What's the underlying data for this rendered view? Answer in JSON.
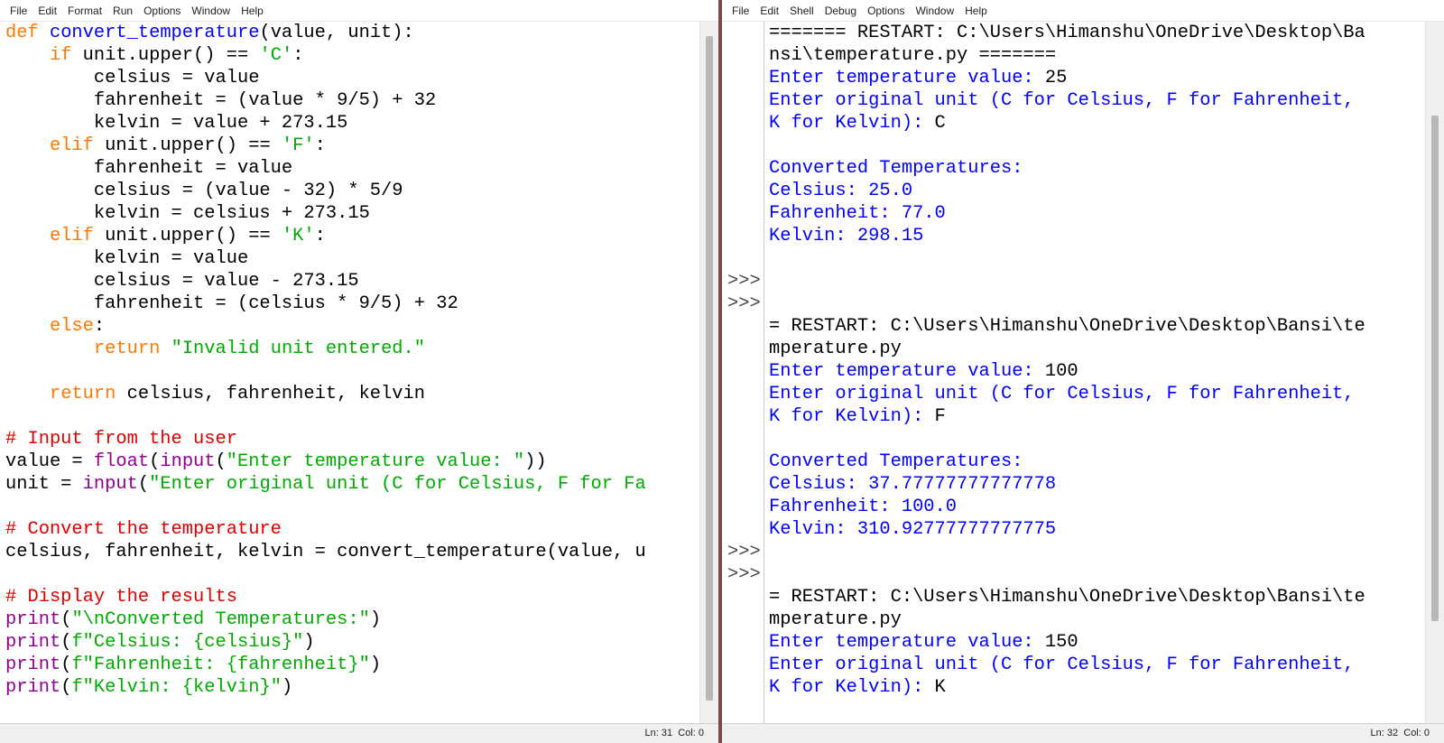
{
  "editor": {
    "menu": [
      "File",
      "Edit",
      "Format",
      "Run",
      "Options",
      "Window",
      "Help"
    ],
    "status": {
      "line": "Ln: 31",
      "col": "Col: 0"
    },
    "code": [
      [
        {
          "t": "def ",
          "c": "kw"
        },
        {
          "t": "convert_temperature",
          "c": "fn"
        },
        {
          "t": "(value, unit):",
          "c": "pl"
        }
      ],
      [
        {
          "t": "    ",
          "c": "pl"
        },
        {
          "t": "if",
          "c": "kw"
        },
        {
          "t": " unit.upper() == ",
          "c": "pl"
        },
        {
          "t": "'C'",
          "c": "str"
        },
        {
          "t": ":",
          "c": "pl"
        }
      ],
      [
        {
          "t": "        celsius = value",
          "c": "pl"
        }
      ],
      [
        {
          "t": "        fahrenheit = (value * 9/5) + 32",
          "c": "pl"
        }
      ],
      [
        {
          "t": "        kelvin = value + 273.15",
          "c": "pl"
        }
      ],
      [
        {
          "t": "    ",
          "c": "pl"
        },
        {
          "t": "elif",
          "c": "kw"
        },
        {
          "t": " unit.upper() == ",
          "c": "pl"
        },
        {
          "t": "'F'",
          "c": "str"
        },
        {
          "t": ":",
          "c": "pl"
        }
      ],
      [
        {
          "t": "        fahrenheit = value",
          "c": "pl"
        }
      ],
      [
        {
          "t": "        celsius = (value - 32) * 5/9",
          "c": "pl"
        }
      ],
      [
        {
          "t": "        kelvin = celsius + 273.15",
          "c": "pl"
        }
      ],
      [
        {
          "t": "    ",
          "c": "pl"
        },
        {
          "t": "elif",
          "c": "kw"
        },
        {
          "t": " unit.upper() == ",
          "c": "pl"
        },
        {
          "t": "'K'",
          "c": "str"
        },
        {
          "t": ":",
          "c": "pl"
        }
      ],
      [
        {
          "t": "        kelvin = value",
          "c": "pl"
        }
      ],
      [
        {
          "t": "        celsius = value - 273.15",
          "c": "pl"
        }
      ],
      [
        {
          "t": "        fahrenheit = (celsius * 9/5) + 32",
          "c": "pl"
        }
      ],
      [
        {
          "t": "    ",
          "c": "pl"
        },
        {
          "t": "else",
          "c": "kw"
        },
        {
          "t": ":",
          "c": "pl"
        }
      ],
      [
        {
          "t": "        ",
          "c": "pl"
        },
        {
          "t": "return",
          "c": "kw"
        },
        {
          "t": " ",
          "c": "pl"
        },
        {
          "t": "\"Invalid unit entered.\"",
          "c": "str"
        }
      ],
      [
        {
          "t": "",
          "c": "pl"
        }
      ],
      [
        {
          "t": "    ",
          "c": "pl"
        },
        {
          "t": "return",
          "c": "kw"
        },
        {
          "t": " celsius, fahrenheit, kelvin",
          "c": "pl"
        }
      ],
      [
        {
          "t": "",
          "c": "pl"
        }
      ],
      [
        {
          "t": "# Input from the user",
          "c": "cm"
        }
      ],
      [
        {
          "t": "value = ",
          "c": "pl"
        },
        {
          "t": "float",
          "c": "bi"
        },
        {
          "t": "(",
          "c": "pl"
        },
        {
          "t": "input",
          "c": "bi"
        },
        {
          "t": "(",
          "c": "pl"
        },
        {
          "t": "\"Enter temperature value: \"",
          "c": "str"
        },
        {
          "t": "))",
          "c": "pl"
        }
      ],
      [
        {
          "t": "unit = ",
          "c": "pl"
        },
        {
          "t": "input",
          "c": "bi"
        },
        {
          "t": "(",
          "c": "pl"
        },
        {
          "t": "\"Enter original unit (C for Celsius, F for Fa",
          "c": "str"
        }
      ],
      [
        {
          "t": "",
          "c": "pl"
        }
      ],
      [
        {
          "t": "# Convert the temperature",
          "c": "cm"
        }
      ],
      [
        {
          "t": "celsius, fahrenheit, kelvin = convert_temperature(value, u",
          "c": "pl"
        }
      ],
      [
        {
          "t": "",
          "c": "pl"
        }
      ],
      [
        {
          "t": "# Display the results",
          "c": "cm"
        }
      ],
      [
        {
          "t": "print",
          "c": "bi"
        },
        {
          "t": "(",
          "c": "pl"
        },
        {
          "t": "\"\\nConverted Temperatures:\"",
          "c": "str"
        },
        {
          "t": ")",
          "c": "pl"
        }
      ],
      [
        {
          "t": "print",
          "c": "bi"
        },
        {
          "t": "(",
          "c": "pl"
        },
        {
          "t": "f\"Celsius: {celsius}\"",
          "c": "str"
        },
        {
          "t": ")",
          "c": "pl"
        }
      ],
      [
        {
          "t": "print",
          "c": "bi"
        },
        {
          "t": "(",
          "c": "pl"
        },
        {
          "t": "f\"Fahrenheit: {fahrenheit}\"",
          "c": "str"
        },
        {
          "t": ")",
          "c": "pl"
        }
      ],
      [
        {
          "t": "print",
          "c": "bi"
        },
        {
          "t": "(",
          "c": "pl"
        },
        {
          "t": "f\"Kelvin: {kelvin}\"",
          "c": "str"
        },
        {
          "t": ")",
          "c": "pl"
        }
      ]
    ]
  },
  "shell": {
    "menu": [
      "File",
      "Edit",
      "Shell",
      "Debug",
      "Options",
      "Window",
      "Help"
    ],
    "status": {
      "line": "Ln: 32",
      "col": "Col: 0"
    },
    "gutter": [
      "",
      "",
      "",
      "",
      "",
      "",
      "",
      "",
      "",
      "",
      "",
      ">>>",
      ">>>",
      "",
      "",
      "",
      "",
      "",
      "",
      "",
      "",
      "",
      "",
      ">>>",
      ">>>",
      "",
      "",
      "",
      "",
      "",
      "",
      "",
      ""
    ],
    "lines": [
      [
        {
          "t": "======= RESTART: C:\\Users\\Himanshu\\OneDrive\\Desktop\\Ba",
          "c": "pl"
        }
      ],
      [
        {
          "t": "nsi\\temperature.py =======",
          "c": "pl"
        }
      ],
      [
        {
          "t": "Enter temperature value: ",
          "c": "out"
        },
        {
          "t": "25",
          "c": "usr"
        }
      ],
      [
        {
          "t": "Enter original unit (C for Celsius, F for Fahrenheit,",
          "c": "out"
        }
      ],
      [
        {
          "t": "K for Kelvin): ",
          "c": "out"
        },
        {
          "t": "C",
          "c": "usr"
        }
      ],
      [
        {
          "t": "",
          "c": "pl"
        }
      ],
      [
        {
          "t": "Converted Temperatures:",
          "c": "out"
        }
      ],
      [
        {
          "t": "Celsius: 25.0",
          "c": "out"
        }
      ],
      [
        {
          "t": "Fahrenheit: 77.0",
          "c": "out"
        }
      ],
      [
        {
          "t": "Kelvin: 298.15",
          "c": "out"
        }
      ],
      [
        {
          "t": "",
          "c": "pl"
        }
      ],
      [
        {
          "t": "",
          "c": "pl"
        }
      ],
      [
        {
          "t": "",
          "c": "pl"
        }
      ],
      [
        {
          "t": "= RESTART: C:\\Users\\Himanshu\\OneDrive\\Desktop\\Bansi\\te",
          "c": "pl"
        }
      ],
      [
        {
          "t": "mperature.py",
          "c": "pl"
        }
      ],
      [
        {
          "t": "Enter temperature value: ",
          "c": "out"
        },
        {
          "t": "100",
          "c": "usr"
        }
      ],
      [
        {
          "t": "Enter original unit (C for Celsius, F for Fahrenheit,",
          "c": "out"
        }
      ],
      [
        {
          "t": "K for Kelvin): ",
          "c": "out"
        },
        {
          "t": "F",
          "c": "usr"
        }
      ],
      [
        {
          "t": "",
          "c": "pl"
        }
      ],
      [
        {
          "t": "Converted Temperatures:",
          "c": "out"
        }
      ],
      [
        {
          "t": "Celsius: 37.77777777777778",
          "c": "out"
        }
      ],
      [
        {
          "t": "Fahrenheit: 100.0",
          "c": "out"
        }
      ],
      [
        {
          "t": "Kelvin: 310.92777777777775",
          "c": "out"
        }
      ],
      [
        {
          "t": "",
          "c": "pl"
        }
      ],
      [
        {
          "t": "",
          "c": "pl"
        }
      ],
      [
        {
          "t": "= RESTART: C:\\Users\\Himanshu\\OneDrive\\Desktop\\Bansi\\te",
          "c": "pl"
        }
      ],
      [
        {
          "t": "mperature.py",
          "c": "pl"
        }
      ],
      [
        {
          "t": "Enter temperature value: ",
          "c": "out"
        },
        {
          "t": "150",
          "c": "usr"
        }
      ],
      [
        {
          "t": "Enter original unit (C for Celsius, F for Fahrenheit,",
          "c": "out"
        }
      ],
      [
        {
          "t": "K for Kelvin): ",
          "c": "out"
        },
        {
          "t": "K",
          "c": "usr"
        }
      ],
      [
        {
          "t": "",
          "c": "pl"
        }
      ],
      [
        {
          "t": "Converted Temperatures:",
          "c": "out"
        }
      ]
    ]
  }
}
